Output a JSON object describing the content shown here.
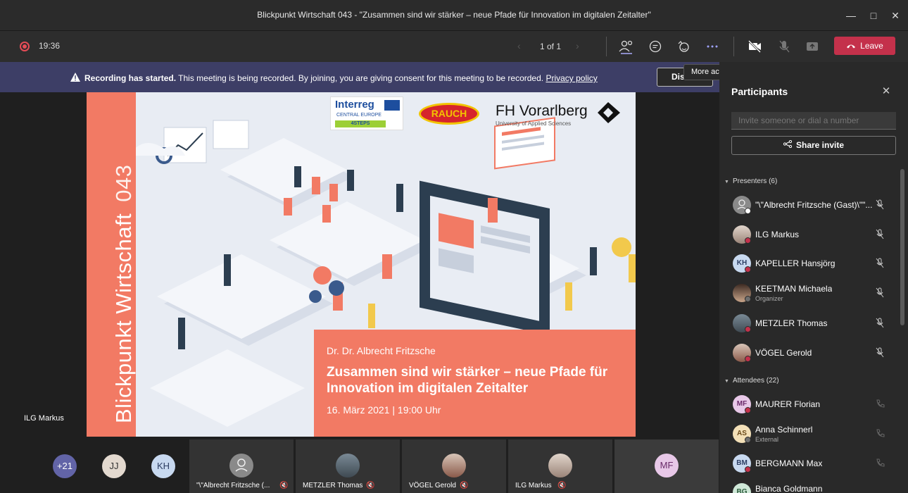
{
  "window": {
    "title": "Blickpunkt Wirtschaft 043 - \"Zusammen sind wir stärker – neue Pfade für Innovation im digitalen Zeitalter\"",
    "controls": [
      "minimize-icon",
      "maximize-icon",
      "close-icon"
    ]
  },
  "toolbar": {
    "recording_time": "19:36",
    "pager": "1 of 1",
    "leave_label": "Leave",
    "icons": [
      "participants-icon",
      "chat-icon",
      "reactions-icon",
      "more-actions-icon",
      "camera-off-icon",
      "mic-off-icon",
      "share-screen-icon",
      "phone-icon"
    ]
  },
  "banner": {
    "bold": "Recording has started.",
    "text": " This meeting is being recorded. By joining, you are giving consent for this meeting to be recorded. ",
    "link": "Privacy policy",
    "dismiss_label": "Dis",
    "tooltip": "More actions"
  },
  "slide": {
    "vertical_title": "Blickpunkt Wirtschaft",
    "episode": "043",
    "presenter": "Dr. Dr. Albrecht Fritzsche",
    "headline": "Zusammen sind wir stärker – neue Pfade für Innovation im digitalen Zeitalter",
    "date": "16. März 2021 | 19:00 Uhr",
    "logos": {
      "interreg": "Interreg",
      "interreg_sub": "CENTRAL EUROPE",
      "interreg_tag": "4STEPS",
      "rauch": "RAUCH",
      "fh": "FH Vorarlberg",
      "fh_sub": "University of Applied Sciences"
    }
  },
  "stage": {
    "speaker_label": "ILG Markus"
  },
  "bottom_strip": {
    "overflow_count": "+21",
    "avatars": [
      "JJ",
      "KH"
    ],
    "tiles": [
      {
        "label": "\"\\\"Albrecht Fritzsche (..."
      },
      {
        "label": "METZLER Thomas"
      },
      {
        "label": "VÖGEL Gerold"
      },
      {
        "label": "ILG Markus"
      }
    ],
    "last_avatar": "MF"
  },
  "panel": {
    "title": "Participants",
    "invite_placeholder": "Invite someone or dial a number",
    "share_label": "Share invite",
    "presenters_header": "Presenters (6)",
    "attendees_header": "Attendees (22)",
    "presenters": [
      {
        "name": "\"\\\"Albrecht Fritzsche (Gast)\\\"\"...",
        "sub": ""
      },
      {
        "name": "ILG Markus",
        "sub": ""
      },
      {
        "name": "KAPELLER Hansjörg",
        "sub": ""
      },
      {
        "name": "KEETMAN Michaela",
        "sub": "Organizer"
      },
      {
        "name": "METZLER Thomas",
        "sub": ""
      },
      {
        "name": "VÖGEL Gerold",
        "sub": ""
      }
    ],
    "attendees": [
      {
        "name": "MAURER Florian",
        "sub": ""
      },
      {
        "name": "Anna Schinnerl",
        "sub": "External"
      },
      {
        "name": "BERGMANN Max",
        "sub": ""
      },
      {
        "name": "Bianca Goldmann",
        "sub": ""
      }
    ],
    "initials": {
      "kh": "KH",
      "mf": "MF",
      "as": "AS",
      "bm": "BM",
      "bg": "BG"
    }
  },
  "colors": {
    "accent": "#6264a7",
    "leave": "#c4314b",
    "slide_accent": "#f27a64"
  }
}
